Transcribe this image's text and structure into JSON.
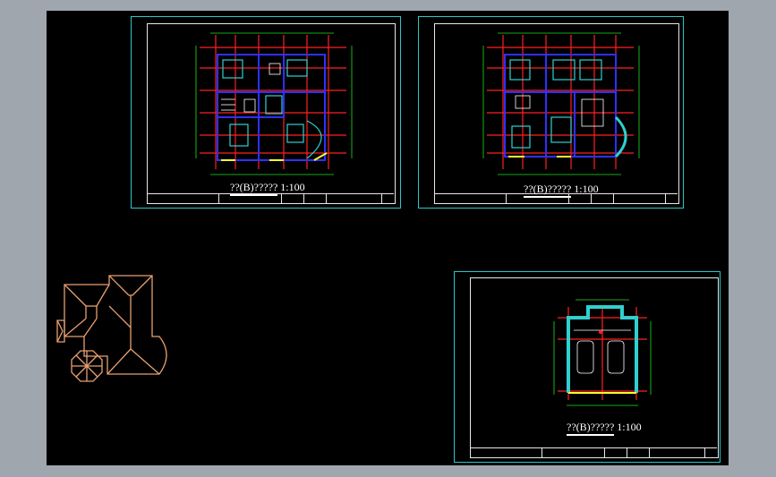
{
  "sheets": [
    {
      "title": "??(B)?????",
      "scale": "1:100"
    },
    {
      "title": "??(B)?????",
      "scale": "1:100"
    },
    {
      "title": "??(B)?????",
      "scale": "1:100"
    }
  ],
  "colors": {
    "background": "#000000",
    "viewport_bg": "#a0a6ae",
    "sheet_border": "#27c8c8",
    "frame": "#e8e8e8",
    "grid_red": "#ff2020",
    "dim_green": "#20e020",
    "wall_blue": "#3030ff",
    "wall_cyan": "#30d0d0",
    "accent_yellow": "#ffff30",
    "roof": "#e8a070"
  }
}
